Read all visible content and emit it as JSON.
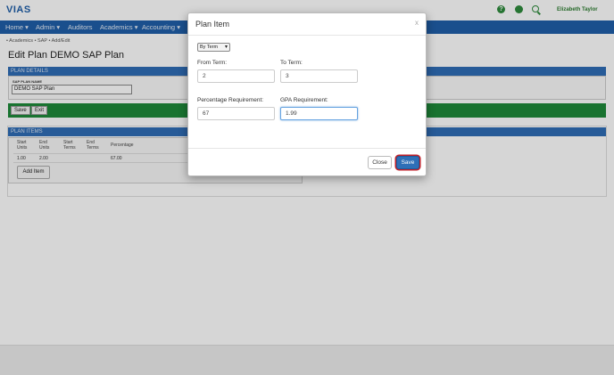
{
  "app": {
    "logo": "VIAS",
    "user": "Elizabeth Taylor",
    "help_glyph": "?"
  },
  "nav": [
    {
      "label": "Home ▾"
    },
    {
      "label": "Admin ▾"
    },
    {
      "label": "Auditors"
    },
    {
      "label": "Academics ▾"
    },
    {
      "label": "Accounting ▾"
    }
  ],
  "breadcrumb": "• Academics  • SAP  • Add/Edit",
  "page_title": "Edit Plan DEMO SAP Plan",
  "plan_details": {
    "header": "PLAN DETAILS",
    "name_label": "SAP PLAN NAME",
    "name_value": "DEMO SAP Plan"
  },
  "actions": {
    "save": "Save",
    "exit": "Exit"
  },
  "plan_items": {
    "header": "PLAN ITEMS",
    "columns": [
      "Start Units",
      "End Units",
      "Start Terms",
      "End Terms",
      "Percentage"
    ],
    "rows": [
      {
        "start_units": "1.00",
        "end_units": "2.00",
        "start_terms": "",
        "end_terms": "",
        "percentage": "67.00"
      }
    ],
    "add_button": "Add Item"
  },
  "modal": {
    "title": "Plan Item",
    "close_glyph": "x",
    "mode": "By Term",
    "from_term_label": "From Term:",
    "from_term_value": "2",
    "to_term_label": "To Term:",
    "to_term_value": "3",
    "percentage_label": "Percentage Requirement:",
    "percentage_value": "67",
    "gpa_label": "GPA Requirement:",
    "gpa_value": "1.99",
    "close_button": "Close",
    "save_button": "Save"
  }
}
